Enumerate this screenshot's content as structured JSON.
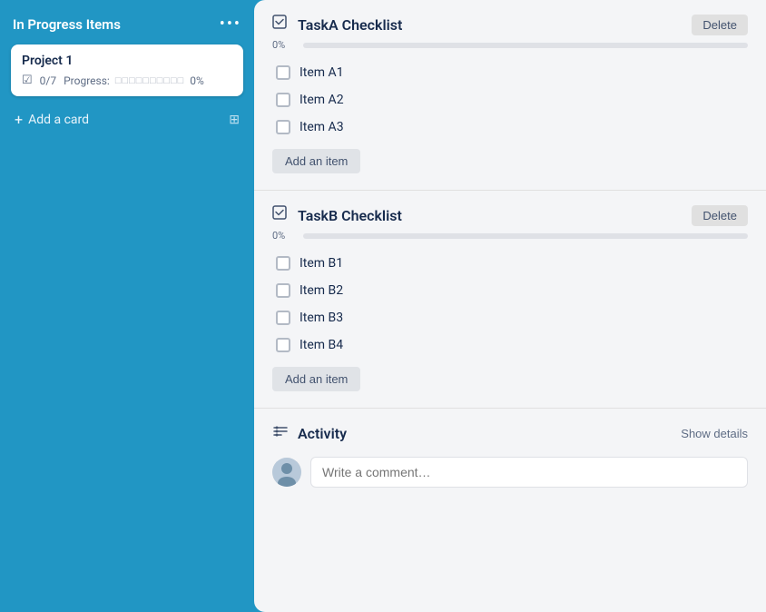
{
  "sidebar": {
    "title": "In Progress Items",
    "menu_icon": "•••",
    "card": {
      "title": "Project 1",
      "checklist_icon": "☑",
      "count": "0/7",
      "progress_label": "Progress:",
      "progress_dots": "□□□□□□□□□□",
      "progress_percent": "0%"
    },
    "add_card_label": "Add a card",
    "add_card_icon": "+"
  },
  "main": {
    "checklists": [
      {
        "id": "taskA",
        "title": "TaskA Checklist",
        "delete_label": "Delete",
        "progress_percent": "0%",
        "progress_value": 0,
        "items": [
          {
            "label": "Item A1",
            "checked": false
          },
          {
            "label": "Item A2",
            "checked": false
          },
          {
            "label": "Item A3",
            "checked": false
          }
        ],
        "add_item_label": "Add an item"
      },
      {
        "id": "taskB",
        "title": "TaskB Checklist",
        "delete_label": "Delete",
        "progress_percent": "0%",
        "progress_value": 0,
        "items": [
          {
            "label": "Item B1",
            "checked": false
          },
          {
            "label": "Item B2",
            "checked": false
          },
          {
            "label": "Item B3",
            "checked": false
          },
          {
            "label": "Item B4",
            "checked": false
          }
        ],
        "add_item_label": "Add an item"
      }
    ],
    "activity": {
      "title": "Activity",
      "show_details_label": "Show details",
      "comment_placeholder": "Write a comment…"
    }
  }
}
